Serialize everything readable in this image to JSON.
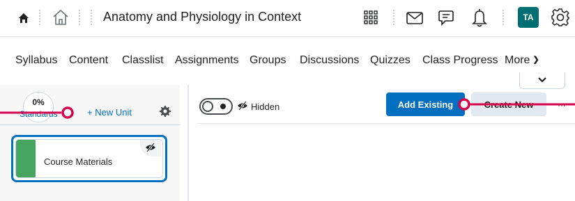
{
  "header": {
    "course_title": "Anatomy and Physiology in Context",
    "avatar_initials": "TA",
    "icons": [
      "home-icon",
      "house-outline-icon",
      "app-grid-icon",
      "mail-icon",
      "chat-icon",
      "bell-icon",
      "gear-icon"
    ]
  },
  "nav": {
    "items": [
      "Syllabus",
      "Content",
      "Classlist",
      "Assignments",
      "Groups",
      "Discussions",
      "Quizzes",
      "Class Progress",
      "More"
    ]
  },
  "left_panel": {
    "standards_percent": "0%",
    "standards_label": "Standards",
    "new_unit_label": "+ New Unit",
    "unit_card_title": "Course Materials",
    "unit_card_color": "#46a661"
  },
  "toolbar": {
    "visibility_label": "Hidden",
    "add_existing_label": "Add Existing",
    "create_new_label": "Create New",
    "more_label": "..."
  },
  "colors": {
    "accent": "#006fbf",
    "annotation": "#d6004d",
    "avatar_bg": "#006f73"
  }
}
